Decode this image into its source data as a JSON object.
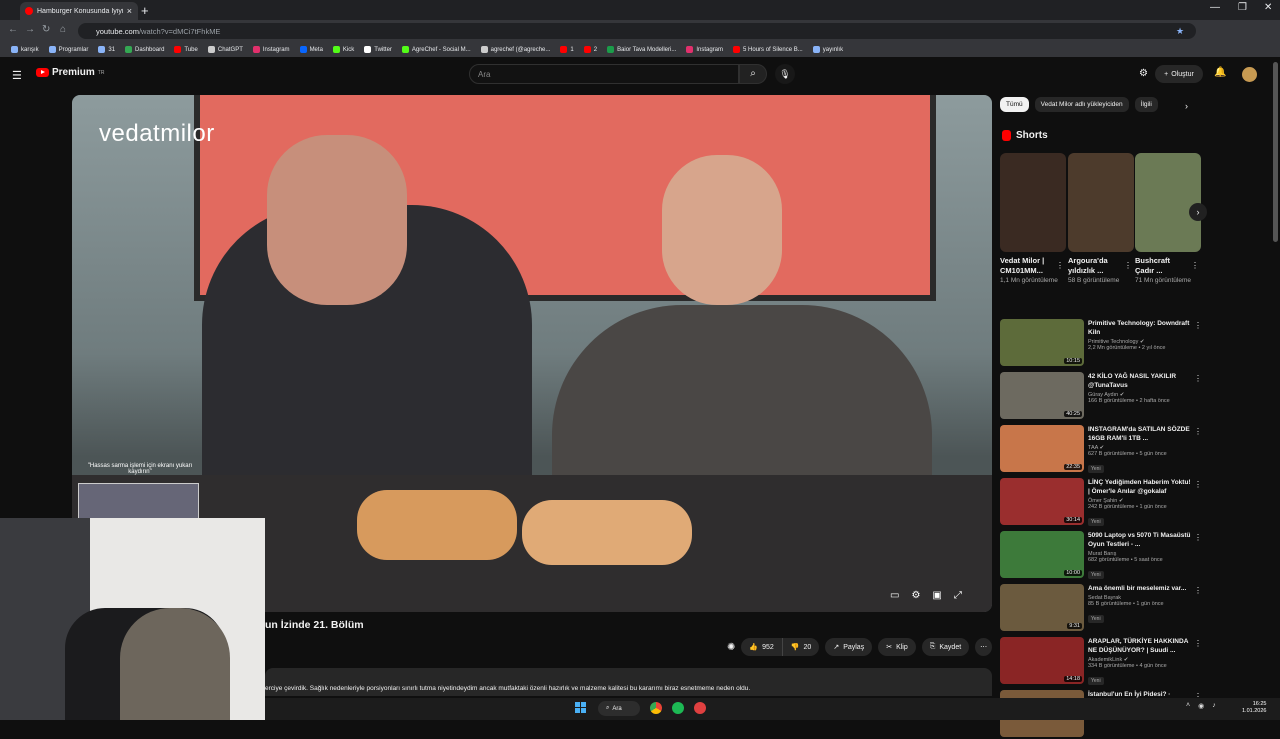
{
  "browser": {
    "tab_title": "Hamburger Konusunda İyiyiz | ...",
    "tab_close": "×",
    "new_tab": "+",
    "url_host": "youtube.com",
    "url_rest": "/watch?v=dMCi7tFhkME",
    "window_controls": [
      "—",
      "❐",
      "✕"
    ],
    "bookmarks": [
      {
        "label": "karışık",
        "color": "#8ab4f8"
      },
      {
        "label": "Programlar",
        "color": "#8ab4f8"
      },
      {
        "label": "31",
        "color": "#8ab4f8"
      },
      {
        "label": "Dashboard",
        "color": "#34a853"
      },
      {
        "label": "Tube",
        "color": "#ff0000"
      },
      {
        "label": "ChatGPT",
        "color": "#cccccc"
      },
      {
        "label": "Instagram",
        "color": "#e1306c"
      },
      {
        "label": "Meta",
        "color": "#0866ff"
      },
      {
        "label": "Kick",
        "color": "#53fc18"
      },
      {
        "label": "Twitter",
        "color": "#ffffff"
      },
      {
        "label": "AgreChef - Social M...",
        "color": "#53fc18"
      },
      {
        "label": "agrechef (@agreche...",
        "color": "#cccccc"
      },
      {
        "label": "1",
        "color": "#ff0000"
      },
      {
        "label": "2",
        "color": "#ff0000"
      },
      {
        "label": "Baior Tava Modelleri...",
        "color": "#1b9c4a"
      },
      {
        "label": "Instagram",
        "color": "#e1306c"
      },
      {
        "label": "5 Hours of Silence B...",
        "color": "#ff0000"
      },
      {
        "label": "yayınlık",
        "color": "#8ab4f8"
      }
    ]
  },
  "header": {
    "logo_text": "Premium",
    "logo_sup": "TR",
    "search_placeholder": "Ara",
    "create_label": "Oluştur"
  },
  "video": {
    "watermark": "vedatmilor",
    "mini_label": "\"Hassas sarma işlemi için ekranı yukarı kaydırın\"",
    "title": "un İzinde 21. Bölüm",
    "likes": "952",
    "dislikes": "20",
    "share": "Paylaş",
    "clip": "Klip",
    "save": "Kaydet",
    "description": "erciye çevirdik. Sağlık nedenleriyle porsiyonları sınırlı tutma niyetindeydim ancak mutfaktaki özenli hazırlık ve malzeme kalitesi bu kararımı biraz esnetmeme neden oldu."
  },
  "chips": [
    "Tümü",
    "Vedat Milor adlı yükleyiciden",
    "İlgili"
  ],
  "shorts": {
    "header": "Shorts",
    "items": [
      {
        "title": "Vedat Milor | CM101MM...",
        "views": "1,1 Mn görüntüleme",
        "color": "#3a2a22"
      },
      {
        "title": "Argoura'da yıldızlık ...",
        "views": "58 B görüntüleme",
        "color": "#4d3b2c"
      },
      {
        "title": "Bushcraft Çadır ...",
        "views": "71 Mn görüntüleme",
        "color": "#6b7a55"
      }
    ]
  },
  "recommendations": [
    {
      "title": "Primitive Technology: Downdraft Kiln",
      "channel": "Primitive Technology ✔",
      "stats": "2,2 Mn görüntüleme • 2 yıl önce",
      "duration": "10:15",
      "badge": "",
      "color": "#5d6b3a"
    },
    {
      "title": "42 KİLO YAĞ NASIL YAKILIR @TunaTavus",
      "channel": "Güray Aydın ✔",
      "stats": "166 B görüntüleme • 2 hafta önce",
      "duration": "40:25",
      "badge": "",
      "color": "#6d6a60"
    },
    {
      "title": "INSTAGRAM'da SATILAN SÖZDE 16GB RAM'li 1TB ...",
      "channel": "TAA ✔",
      "stats": "627 B görüntüleme • 5 gün önce",
      "duration": "22:35",
      "badge": "Yeni",
      "color": "#c8764a"
    },
    {
      "title": "LİNÇ Yediğimden Haberim Yoktu! | Ömer'le Anılar @gokalaf",
      "channel": "Ömer Şahin ✔",
      "stats": "242 B görüntüleme • 1 gün önce",
      "duration": "30:14",
      "badge": "Yeni",
      "color": "#9a2e2e"
    },
    {
      "title": "5090 Laptop vs 5070 Ti Masaüstü Oyun Testleri - ...",
      "channel": "Murat Barış",
      "stats": "682 görüntüleme • 5 saat önce",
      "duration": "10:00",
      "badge": "Yeni",
      "color": "#3d7a3a"
    },
    {
      "title": "Ama önemli bir meselemiz var...",
      "channel": "Sedat Bayrak",
      "stats": "85 B görüntüleme • 1 gün önce",
      "duration": "9:31",
      "badge": "Yeni",
      "color": "#6b5a3e"
    },
    {
      "title": "ARAPLAR, TÜRKİYE HAKKINDA NE DÜŞÜNÜYOR? | Suudi ...",
      "channel": "AkademikLink ✔",
      "stats": "334 B görüntüleme • 4 gün önce",
      "duration": "14:18",
      "badge": "Yeni",
      "color": "#8a2525"
    },
    {
      "title": "İstanbul'un En İyi Pidesi? ·",
      "channel": "",
      "stats": "",
      "duration": "",
      "badge": "",
      "color": "#7a5a3a"
    }
  ],
  "taskbar": {
    "search_label": "Ara",
    "time": "16:25",
    "date": "1.01.2026"
  }
}
